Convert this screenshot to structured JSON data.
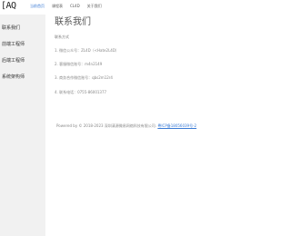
{
  "header": {
    "logo_text": "[AQ",
    "nav": [
      {
        "label": "当前首页"
      },
      {
        "label": "课程表"
      },
      {
        "label": "CL4D"
      },
      {
        "label": "关于我们"
      }
    ]
  },
  "sidebar": {
    "items": [
      {
        "label": "联系我们"
      },
      {
        "label": "前端工程师"
      },
      {
        "label": "后端工程师"
      },
      {
        "label": "系统架构师"
      }
    ]
  },
  "main": {
    "title": "联系我们",
    "subtitle": "联系方式",
    "lines": [
      "1. 微信公众号：ZL4D（<Hate2L4D）",
      "2. 客服微信账号：m4n2149",
      "3. 商务合作微信账号：qbs2m12r4",
      "4. 联系电话：0755-86001377"
    ],
    "footer_text": "Powered by © 2018-2023 深圳清源微易网络科技有限公司.",
    "footer_link": "粤ICP备18056039号-2"
  },
  "colors": {
    "accent": "#3a7bd5",
    "sidebar_bg": "#f1f1f1"
  }
}
